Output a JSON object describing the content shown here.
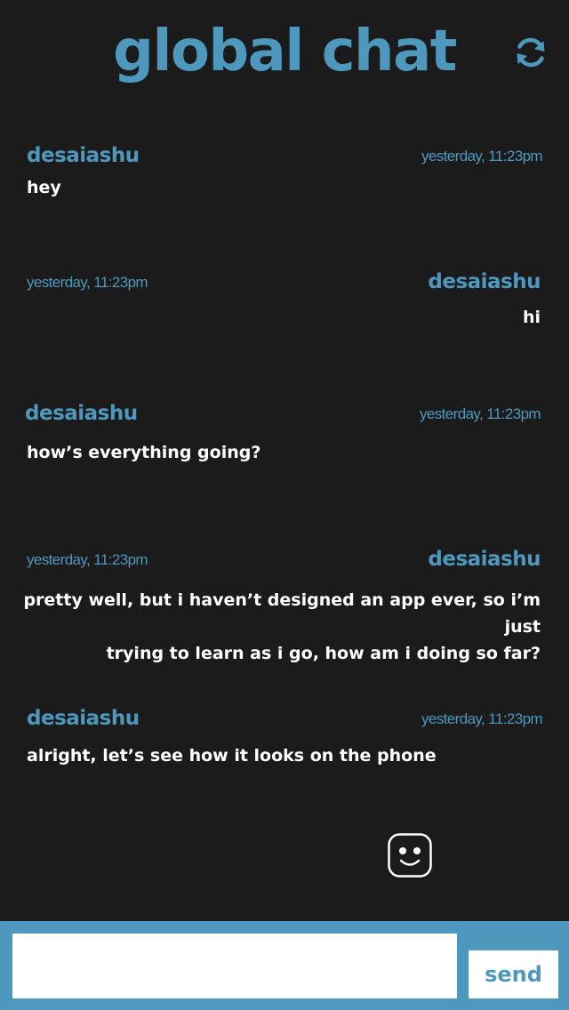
{
  "header": {
    "title": "global chat",
    "refresh_icon": "refresh-icon"
  },
  "messages": [
    {
      "user": "desaiashu",
      "time": "yesterday, 11:23pm",
      "text": "hey",
      "align": "left"
    },
    {
      "user": "desaiashu",
      "time": "yesterday, 11:23pm",
      "text": "hi",
      "align": "right"
    },
    {
      "user": "desaiashu",
      "time": "yesterday, 11:23pm",
      "text": "how’s everything going?",
      "align": "left"
    },
    {
      "user": "desaiashu",
      "time": "yesterday, 11:23pm",
      "text_lines": [
        "pretty well, but i haven’t designed an app ever, so i’m just",
        "trying to learn as i go, how am i doing so far?"
      ],
      "align": "right"
    },
    {
      "user": "desaiashu",
      "time": "yesterday, 11:23pm",
      "text": "alright, let’s see how it looks on the phone",
      "align": "left"
    }
  ],
  "emoji_icon": "smiley-face-icon",
  "composer": {
    "input_value": "",
    "send_label": "send"
  },
  "colors": {
    "background": "#1b1b1c",
    "accent": "#4e98bd",
    "text": "#ffffff"
  }
}
